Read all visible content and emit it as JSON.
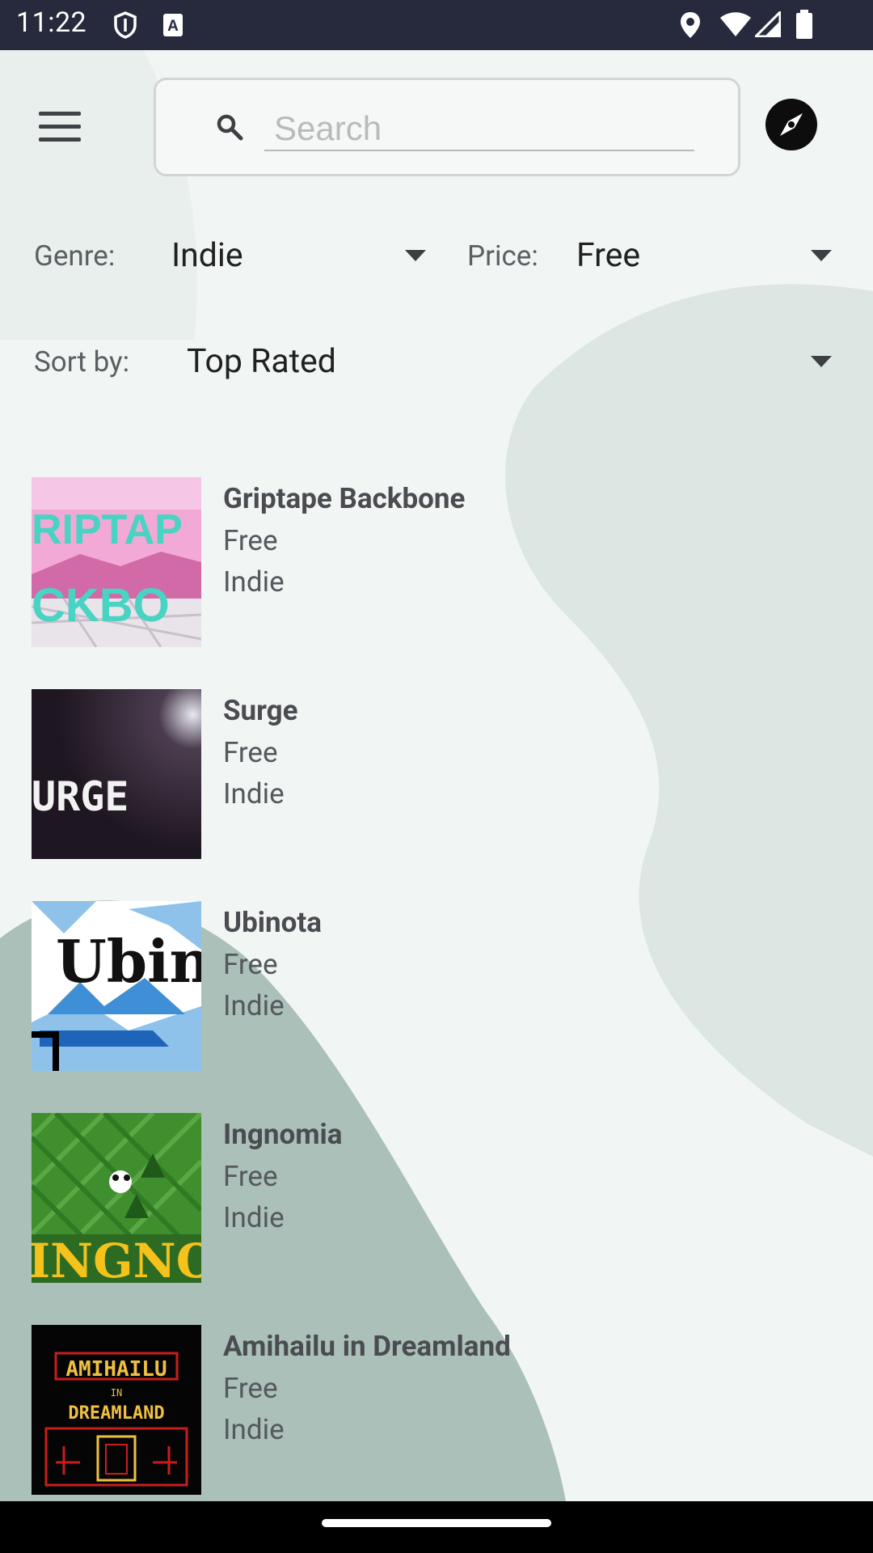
{
  "status_bar": {
    "time": "11:22",
    "left_icons": [
      "shield-icon",
      "keyboard-a-icon"
    ],
    "right_icons": [
      "location-icon",
      "wifi-icon",
      "signal-icon",
      "battery-icon"
    ]
  },
  "header": {
    "menu_icon": "hamburger-menu-icon",
    "search": {
      "placeholder": "Search",
      "value": "",
      "icon": "search-icon"
    },
    "explore_icon": "compass-icon"
  },
  "filters": {
    "genre_label": "Genre:",
    "genre_value": "Indie",
    "price_label": "Price:",
    "price_value": "Free",
    "sort_label": "Sort by:",
    "sort_value": "Top Rated"
  },
  "games": [
    {
      "title": "Griptape Backbone",
      "price": "Free",
      "genre": "Indie",
      "thumb_text": [
        "RIPTAP",
        "CKBO"
      ]
    },
    {
      "title": "Surge",
      "price": "Free",
      "genre": "Indie",
      "thumb_text": [
        "URGE"
      ]
    },
    {
      "title": "Ubinota",
      "price": "Free",
      "genre": "Indie",
      "thumb_text": [
        "Ubin"
      ]
    },
    {
      "title": "Ingnomia",
      "price": "Free",
      "genre": "Indie",
      "thumb_text": [
        "INGNOM"
      ]
    },
    {
      "title": "Amihailu in Dreamland",
      "price": "Free",
      "genre": "Indie",
      "thumb_text": [
        "AMIHAILU",
        "IN",
        "DREAMLAND"
      ]
    }
  ],
  "colors": {
    "background": "#f1f5f3",
    "blob": "#dde6e3",
    "blob_dark": "#a9bfb7",
    "status_bar": "#262a3c"
  }
}
